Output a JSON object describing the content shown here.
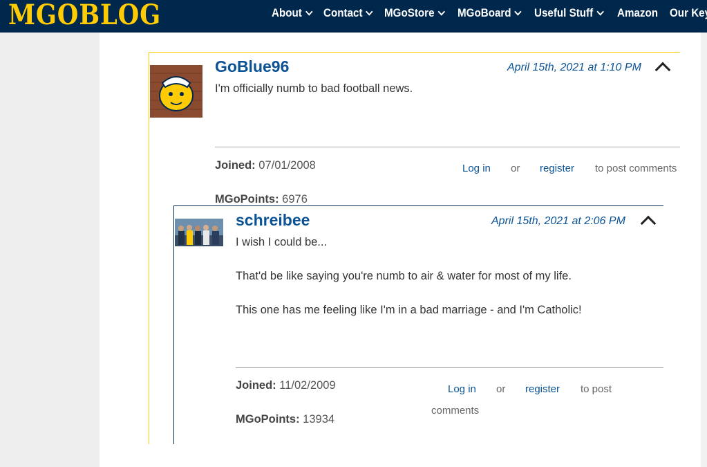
{
  "header": {
    "logo": "MGOBLOG",
    "nav": [
      {
        "label": "About",
        "dropdown": true
      },
      {
        "label": "Contact",
        "dropdown": true
      },
      {
        "label": "MGoStore",
        "dropdown": true
      },
      {
        "label": "MGoBoard",
        "dropdown": true
      },
      {
        "label": "Useful Stuff",
        "dropdown": true
      },
      {
        "label": "Amazon",
        "dropdown": false
      },
      {
        "label": "Our Key",
        "dropdown": false
      }
    ]
  },
  "comments": [
    {
      "author": "GoBlue96",
      "date": "April 15th, 2021 at 1:10 PM",
      "paragraphs": [
        "I'm officially numb to bad football news."
      ],
      "joined_label": "Joined:",
      "joined": "07/01/2008",
      "points_label": "MGoPoints:",
      "points": "6976",
      "login": "Log in",
      "or": "or",
      "register": "register",
      "post": "to post comments"
    },
    {
      "author": "schreibee",
      "date": "April 15th, 2021 at 2:06 PM",
      "paragraphs": [
        "I wish I could be...",
        "That'd be like saying you're numb to air & water for most of my life.",
        "This one has me feeling like I'm in a bad marriage - and I'm Catholic!"
      ],
      "joined_label": "Joined:",
      "joined": "11/02/2009",
      "points_label": "MGoPoints:",
      "points": "13934",
      "login": "Log in",
      "or": "or",
      "register": "register",
      "post_1": "to post",
      "post_2": "comments"
    }
  ],
  "colors": {
    "brand_navy": "#00274c",
    "brand_maize": "#ffcb05",
    "link_blue": "#0b5394"
  }
}
